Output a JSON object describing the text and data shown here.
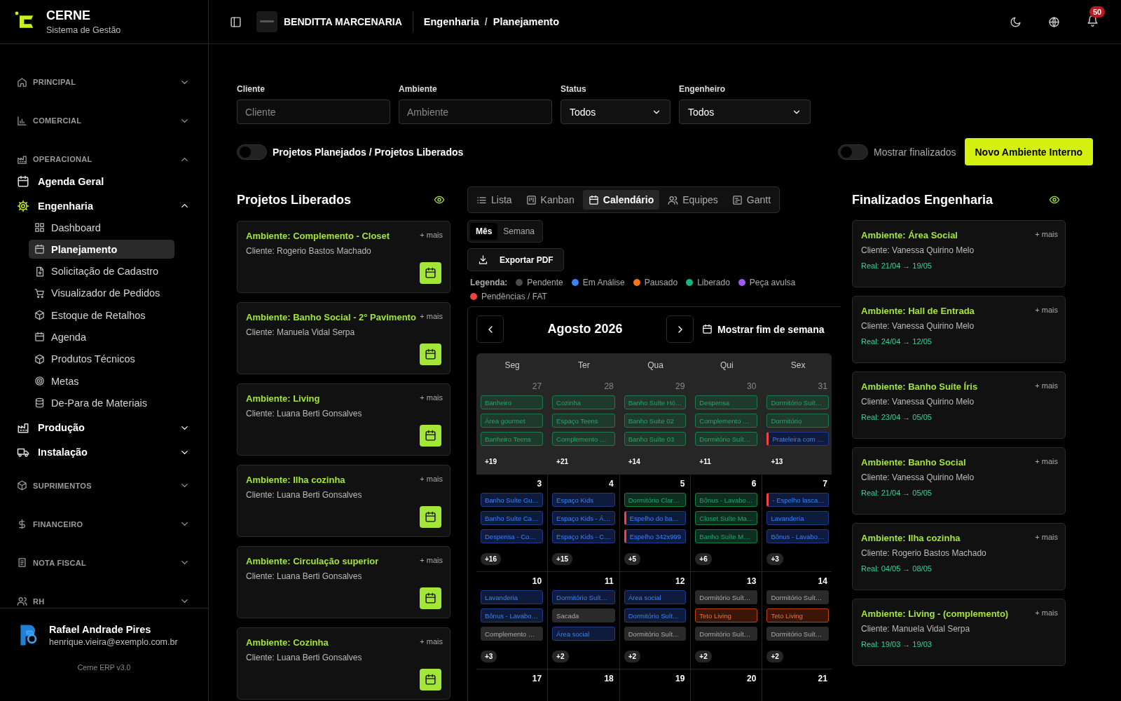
{
  "sidebar": {
    "brand": {
      "name": "CERNE",
      "subtitle": "Sistema de Gestão"
    },
    "sections": [
      {
        "label": "PRINCIPAL",
        "expanded": false
      },
      {
        "label": "COMERCIAL",
        "expanded": false
      },
      {
        "label": "OPERACIONAL",
        "expanded": true,
        "items": [
          {
            "label": "Agenda Geral"
          },
          {
            "label": "Engenharia",
            "expanded": true,
            "children": [
              {
                "label": "Dashboard",
                "selected": false
              },
              {
                "label": "Planejamento",
                "selected": true
              },
              {
                "label": "Solicitação de Cadastro",
                "selected": false
              },
              {
                "label": "Visualizador de Pedidos",
                "selected": false
              },
              {
                "label": "Estoque de Retalhos",
                "selected": false
              },
              {
                "label": "Agenda",
                "selected": false
              },
              {
                "label": "Produtos Técnicos",
                "selected": false
              },
              {
                "label": "Metas",
                "selected": false
              },
              {
                "label": "De-Para de Materiais",
                "selected": false
              }
            ]
          },
          {
            "label": "Produção",
            "expanded": false
          },
          {
            "label": "Instalação",
            "expanded": false
          }
        ]
      },
      {
        "label": "SUPRIMENTOS",
        "expanded": false
      },
      {
        "label": "FINANCEIRO",
        "expanded": false
      },
      {
        "label": "NOTA FISCAL",
        "expanded": false
      },
      {
        "label": "RH",
        "expanded": false
      }
    ],
    "user": {
      "name": "Rafael Andrade Pires",
      "email": "henrique.vieira@exemplo.com.br"
    },
    "version": "Cerne ERP v3.0"
  },
  "topbar": {
    "company": "BENDITTA MARCENARIA",
    "breadcrumb": [
      "Engenharia",
      "Planejamento"
    ],
    "separator": "/",
    "notifications": "50"
  },
  "filters": [
    {
      "label": "Cliente",
      "kind": "input",
      "placeholder": "Cliente"
    },
    {
      "label": "Ambiente",
      "kind": "input",
      "placeholder": "Ambiente"
    },
    {
      "label": "Status",
      "kind": "select",
      "value": "Todos"
    },
    {
      "label": "Engenheiro",
      "kind": "select",
      "value": "Todos"
    }
  ],
  "toggles": [
    {
      "label": "Projetos Planejados / Projetos Liberados",
      "on": false
    },
    {
      "label": "Mostrar finalizados",
      "on": false
    }
  ],
  "primary_button": "Novo Ambiente Interno",
  "released": {
    "title": "Projetos Liberados",
    "cards": [
      {
        "title": "Ambiente: Complemento - Closet",
        "more": "+ mais",
        "client": "Cliente: Rogerio Bastos Machado"
      },
      {
        "title": "Ambiente: Banho Social - 2° Pavimento",
        "more": "+ mais",
        "client": "Cliente: Manuela Vidal Serpa"
      },
      {
        "title": "Ambiente: Living",
        "more": "+ mais",
        "client": "Cliente: Luana Berti Gonsalves"
      },
      {
        "title": "Ambiente: Ilha cozinha",
        "more": "+ mais",
        "client": "Cliente: Luana Berti Gonsalves"
      },
      {
        "title": "Ambiente: Circulação superior",
        "more": "+ mais",
        "client": "Cliente: Luana Berti Gonsalves"
      },
      {
        "title": "Ambiente: Cozinha",
        "more": "+ mais",
        "client": "Cliente: Luana Berti Gonsalves"
      }
    ]
  },
  "finished": {
    "title": "Finalizados Engenharia",
    "cards": [
      {
        "title": "Ambiente: Área Social",
        "more": "+ mais",
        "client": "Cliente: Vanessa Quirino Melo",
        "dates": "Real: 21/04 → 19/05"
      },
      {
        "title": "Ambiente: Hall de Entrada",
        "more": "+ mais",
        "client": "Cliente: Vanessa Quirino Melo",
        "dates": "Real: 24/04 → 12/05"
      },
      {
        "title": "Ambiente: Banho Suíte Íris",
        "more": "+ mais",
        "client": "Cliente: Vanessa Quirino Melo",
        "dates": "Real: 23/04 → 05/05"
      },
      {
        "title": "Ambiente: Banho Social",
        "more": "+ mais",
        "client": "Cliente: Vanessa Quirino Melo",
        "dates": "Real: 21/04 → 05/05"
      },
      {
        "title": "Ambiente: Ilha cozinha",
        "more": "+ mais",
        "client": "Cliente: Rogerio Bastos Machado",
        "dates": "Real: 04/05 → 08/05"
      },
      {
        "title": "Ambiente: Living - (complemento)",
        "more": "+ mais",
        "client": "Cliente: Manuela Vidal Serpa",
        "dates": "Real: 19/03 → 19/03"
      }
    ]
  },
  "views": [
    {
      "label": "Lista",
      "selected": false
    },
    {
      "label": "Kanban",
      "selected": false
    },
    {
      "label": "Calendário",
      "selected": true
    },
    {
      "label": "Equipes",
      "selected": false
    },
    {
      "label": "Gantt",
      "selected": false
    }
  ],
  "ranges": [
    {
      "label": "Mês",
      "selected": true
    },
    {
      "label": "Semana",
      "selected": false
    }
  ],
  "export_button": "Exportar PDF",
  "legend": {
    "title": "Legenda:",
    "items": [
      {
        "label": "Pendente",
        "color": "#4b4b4b"
      },
      {
        "label": "Em Análise",
        "color": "#3b82f6"
      },
      {
        "label": "Pausado",
        "color": "#f97316"
      },
      {
        "label": "Liberado",
        "color": "#10b981"
      },
      {
        "label": "Peça avulsa",
        "color": "#a855f7"
      },
      {
        "label": "Pendências / FAT",
        "color": "#ef4444"
      }
    ]
  },
  "calendar": {
    "title": "Agosto 2026",
    "weekend_toggle": "Mostrar fim de semana",
    "weekdays": [
      "Seg",
      "Ter",
      "Qua",
      "Qui",
      "Sex"
    ],
    "weeks": [
      [
        {
          "day": "27",
          "outside": true,
          "more": "+19",
          "events": [
            {
              "label": "Banheiro",
              "kind": "liberado",
              "flag": false
            },
            {
              "label": "Área gourmet",
              "kind": "liberado",
              "flag": false
            },
            {
              "label": "Banheiro Teens",
              "kind": "liberado",
              "flag": false
            }
          ]
        },
        {
          "day": "28",
          "outside": true,
          "more": "+21",
          "events": [
            {
              "label": "Cozinha",
              "kind": "liberado",
              "flag": false
            },
            {
              "label": "Espaço Teens",
              "kind": "liberado",
              "flag": false
            },
            {
              "label": "Complemento …",
              "kind": "liberado",
              "flag": false
            }
          ]
        },
        {
          "day": "29",
          "outside": true,
          "more": "+14",
          "events": [
            {
              "label": "Banho Suíte Hó…",
              "kind": "liberado",
              "flag": false
            },
            {
              "label": "Banho Suite 02",
              "kind": "liberado",
              "flag": false
            },
            {
              "label": "Banho Suíte 03",
              "kind": "liberado",
              "flag": false
            }
          ]
        },
        {
          "day": "30",
          "outside": true,
          "more": "+11",
          "events": [
            {
              "label": "Despensa",
              "kind": "liberado",
              "flag": false
            },
            {
              "label": "Complemento …",
              "kind": "liberado",
              "flag": false
            },
            {
              "label": "Dormitório Suít…",
              "kind": "liberado",
              "flag": false
            }
          ]
        },
        {
          "day": "31",
          "outside": true,
          "more": "+13",
          "events": [
            {
              "label": "Dormitório Suít…",
              "kind": "liberado",
              "flag": false
            },
            {
              "label": "Dormitório",
              "kind": "liberado",
              "flag": false
            },
            {
              "label": "Prateleira com …",
              "kind": "analise",
              "flag": true
            }
          ]
        }
      ],
      [
        {
          "day": "3",
          "outside": false,
          "more": "+16",
          "events": [
            {
              "label": "Banho Suíte Gu…",
              "kind": "analise",
              "flag": false
            },
            {
              "label": "Banho Suíte Ca…",
              "kind": "analise",
              "flag": false
            },
            {
              "label": "Despensa - Co…",
              "kind": "analise",
              "flag": false
            }
          ]
        },
        {
          "day": "4",
          "outside": false,
          "more": "+15",
          "events": [
            {
              "label": "Espaço Kids",
              "kind": "analise",
              "flag": false
            },
            {
              "label": "Espaço Kids - Á…",
              "kind": "analise",
              "flag": false
            },
            {
              "label": "Espaço Kids - C…",
              "kind": "analise",
              "flag": false
            }
          ]
        },
        {
          "day": "5",
          "outside": false,
          "more": "+5",
          "events": [
            {
              "label": "Dormitório Clar…",
              "kind": "liberado",
              "flag": false
            },
            {
              "label": "Espelho do ba…",
              "kind": "analise",
              "flag": true
            },
            {
              "label": "Espelho 342x999",
              "kind": "analise",
              "flag": true
            }
          ]
        },
        {
          "day": "6",
          "outside": false,
          "more": "+6",
          "events": [
            {
              "label": "Bônus - Lavabo…",
              "kind": "liberado",
              "flag": false
            },
            {
              "label": "Closet Suíte Ma…",
              "kind": "liberado",
              "flag": false
            },
            {
              "label": "Banho Suíte M…",
              "kind": "liberado",
              "flag": false
            }
          ]
        },
        {
          "day": "7",
          "outside": false,
          "more": "+3",
          "events": [
            {
              "label": "- Espelho lasca…",
              "kind": "analise",
              "flag": true
            },
            {
              "label": "Lavanderia",
              "kind": "analise",
              "flag": false
            },
            {
              "label": "Bônus - Lavabo…",
              "kind": "analise",
              "flag": false
            }
          ]
        }
      ],
      [
        {
          "day": "10",
          "outside": false,
          "more": "+3",
          "events": [
            {
              "label": "Lavanderia",
              "kind": "analise",
              "flag": false
            },
            {
              "label": "Bônus - Lavabo…",
              "kind": "analise",
              "flag": false
            },
            {
              "label": "Complemento …",
              "kind": "pendente",
              "flag": false
            }
          ]
        },
        {
          "day": "11",
          "outside": false,
          "more": "+2",
          "events": [
            {
              "label": "Dormitório Suít…",
              "kind": "analise",
              "flag": false
            },
            {
              "label": "Sacada",
              "kind": "pendente",
              "flag": false
            },
            {
              "label": "Área social",
              "kind": "analise",
              "flag": false
            }
          ]
        },
        {
          "day": "12",
          "outside": false,
          "more": "+2",
          "events": [
            {
              "label": "Área social",
              "kind": "analise",
              "flag": false
            },
            {
              "label": "Dormitório Suít…",
              "kind": "analise",
              "flag": false
            },
            {
              "label": "Dormitório Suít…",
              "kind": "pendente",
              "flag": false
            }
          ]
        },
        {
          "day": "13",
          "outside": false,
          "more": "+2",
          "events": [
            {
              "label": "Dormitório Suít…",
              "kind": "pendente",
              "flag": false
            },
            {
              "label": "Teto Living",
              "kind": "pausado",
              "flag": false
            },
            {
              "label": "Dormitório Suít…",
              "kind": "pendente",
              "flag": false
            }
          ]
        },
        {
          "day": "14",
          "outside": false,
          "more": "+2",
          "events": [
            {
              "label": "Dormitório Suít…",
              "kind": "pendente",
              "flag": false
            },
            {
              "label": "Teto Living",
              "kind": "pausado",
              "flag": false
            },
            {
              "label": "Dormitório Suít…",
              "kind": "pendente",
              "flag": false
            }
          ]
        }
      ],
      [
        {
          "day": "17",
          "outside": false
        },
        {
          "day": "18",
          "outside": false
        },
        {
          "day": "19",
          "outside": false
        },
        {
          "day": "20",
          "outside": false
        },
        {
          "day": "21",
          "outside": false
        }
      ]
    ]
  }
}
